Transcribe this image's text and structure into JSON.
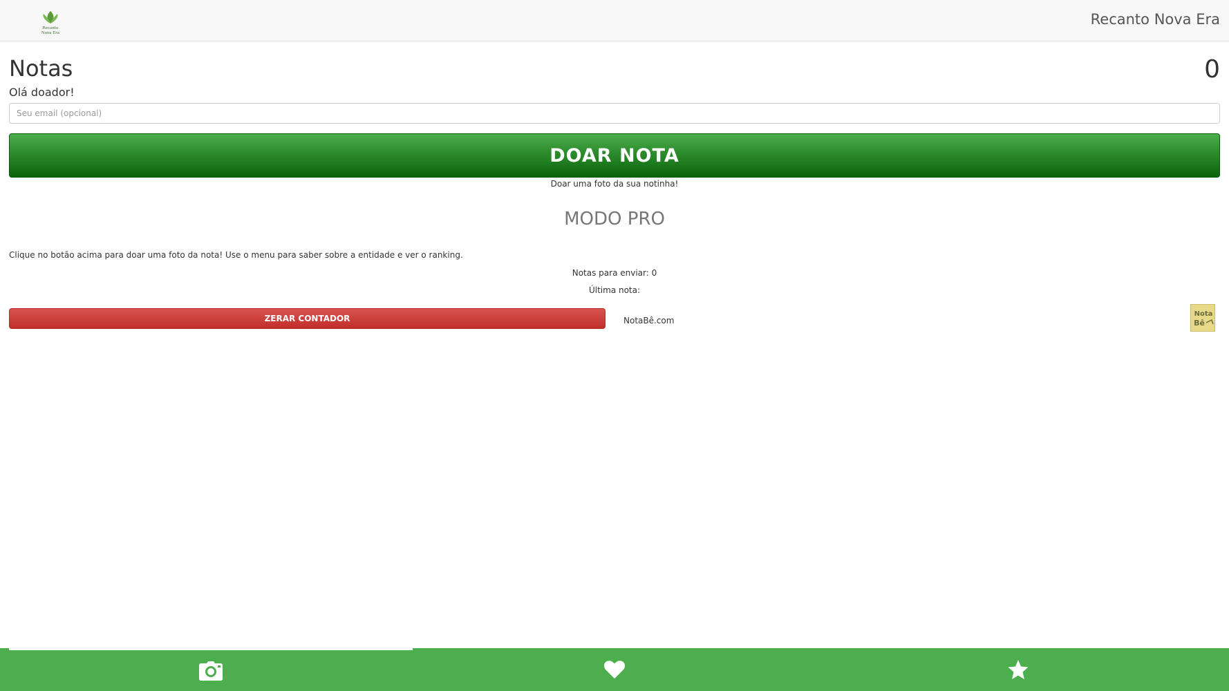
{
  "header": {
    "logo_lines": [
      "Recanto",
      "Nova Era"
    ],
    "brand": "Recanto Nova Era"
  },
  "main": {
    "title": "Notas",
    "counter": "0",
    "greeting": "Olá doador!",
    "email_placeholder": "Seu email (opcional)",
    "donate_label": "DOAR NOTA",
    "donate_sub": "Doar uma foto da sua notinha!",
    "pro_title": "MODO PRO",
    "instructions": "Clique no botão acima para doar uma foto da nota! Use o menu para saber sobre a entidade e ver o ranking.",
    "pending": "Notas para enviar: 0",
    "last_note": "Última nota:",
    "reset_label": "ZERAR CONTADOR",
    "notabe_link": "NotaBê.com",
    "notabe_badge": [
      "Nota",
      "Bê"
    ]
  },
  "bottom_nav": {
    "tabs": [
      {
        "icon": "camera-icon",
        "active": true
      },
      {
        "icon": "heart-icon",
        "active": false
      },
      {
        "icon": "star-icon",
        "active": false
      }
    ]
  },
  "colors": {
    "green": "#4cae4c",
    "dark_green": "#0c630c",
    "red": "#d9534f"
  }
}
